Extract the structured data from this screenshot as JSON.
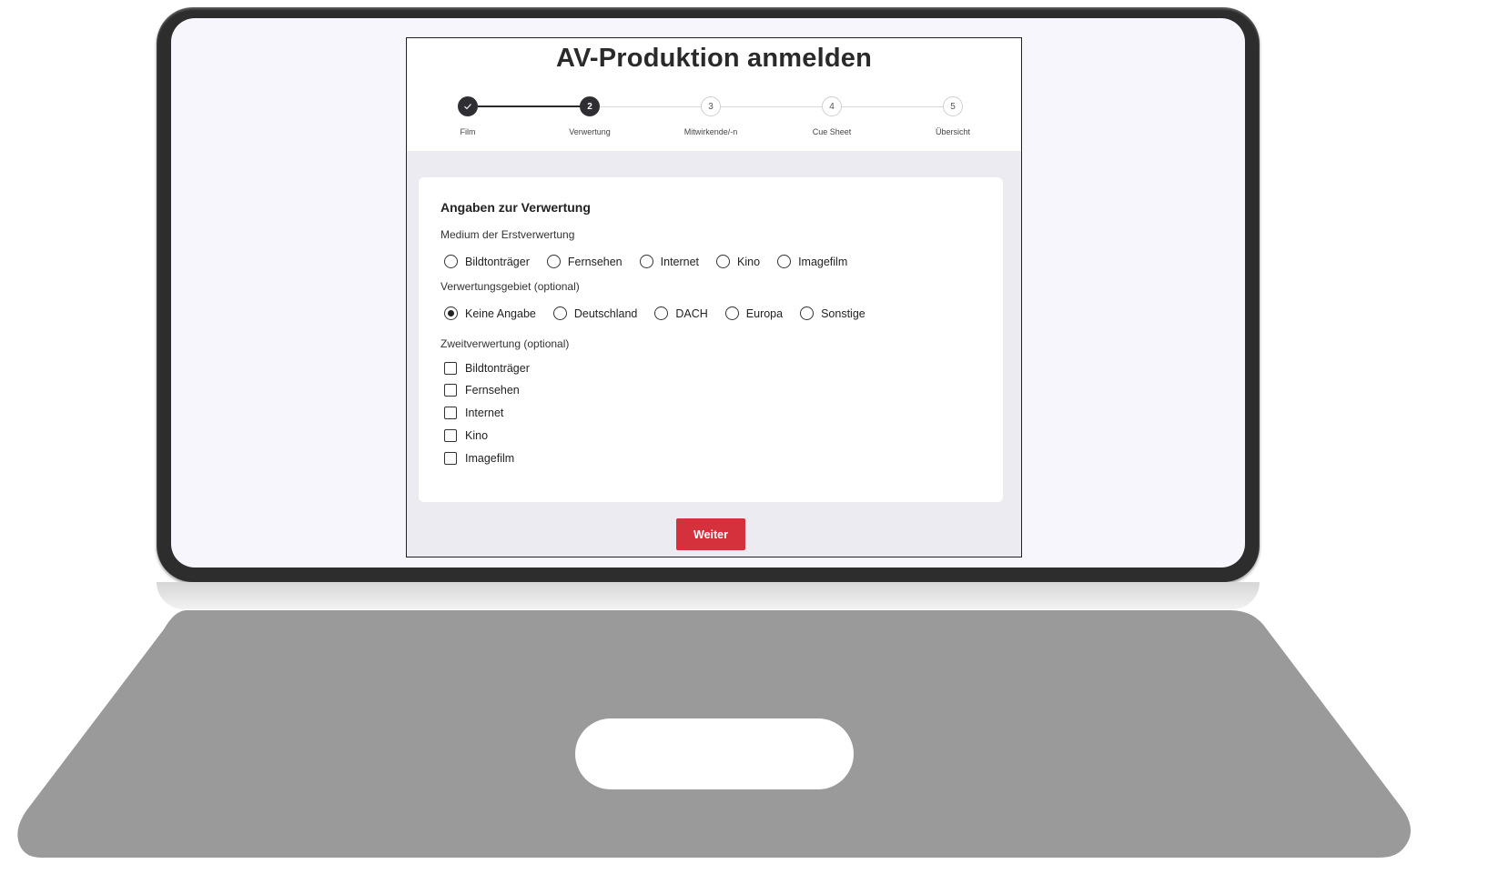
{
  "title": "AV-Produktion anmelden",
  "stepper": {
    "steps": [
      {
        "number": "",
        "label": "Film",
        "state": "completed",
        "icon": "check-icon"
      },
      {
        "number": "2",
        "label": "Verwertung",
        "state": "current"
      },
      {
        "number": "3",
        "label": "Mitwirkende/-n",
        "state": "upcoming"
      },
      {
        "number": "4",
        "label": "Cue Sheet",
        "state": "upcoming"
      },
      {
        "number": "5",
        "label": "Übersicht",
        "state": "upcoming"
      }
    ]
  },
  "section": {
    "title": "Angaben zur Verwertung",
    "medium": {
      "label": "Medium der Erstverwertung",
      "options": [
        "Bildtonträger",
        "Fernsehen",
        "Internet",
        "Kino",
        "Imagefilm"
      ],
      "selected": null
    },
    "gebiet": {
      "label": "Verwertungsgebiet (optional)",
      "options": [
        "Keine Angabe",
        "Deutschland",
        "DACH",
        "Europa",
        "Sonstige"
      ],
      "selected": "Keine Angabe"
    },
    "zweit": {
      "label": "Zweitverwertung (optional)",
      "options": [
        "Bildtonträger",
        "Fernsehen",
        "Internet",
        "Kino",
        "Imagefilm"
      ],
      "checked": []
    }
  },
  "button": {
    "next_label": "Weiter"
  },
  "colors": {
    "accent": "#d4313d",
    "step_active": "#2f2f33",
    "panel_bg": "#ebebf1"
  }
}
